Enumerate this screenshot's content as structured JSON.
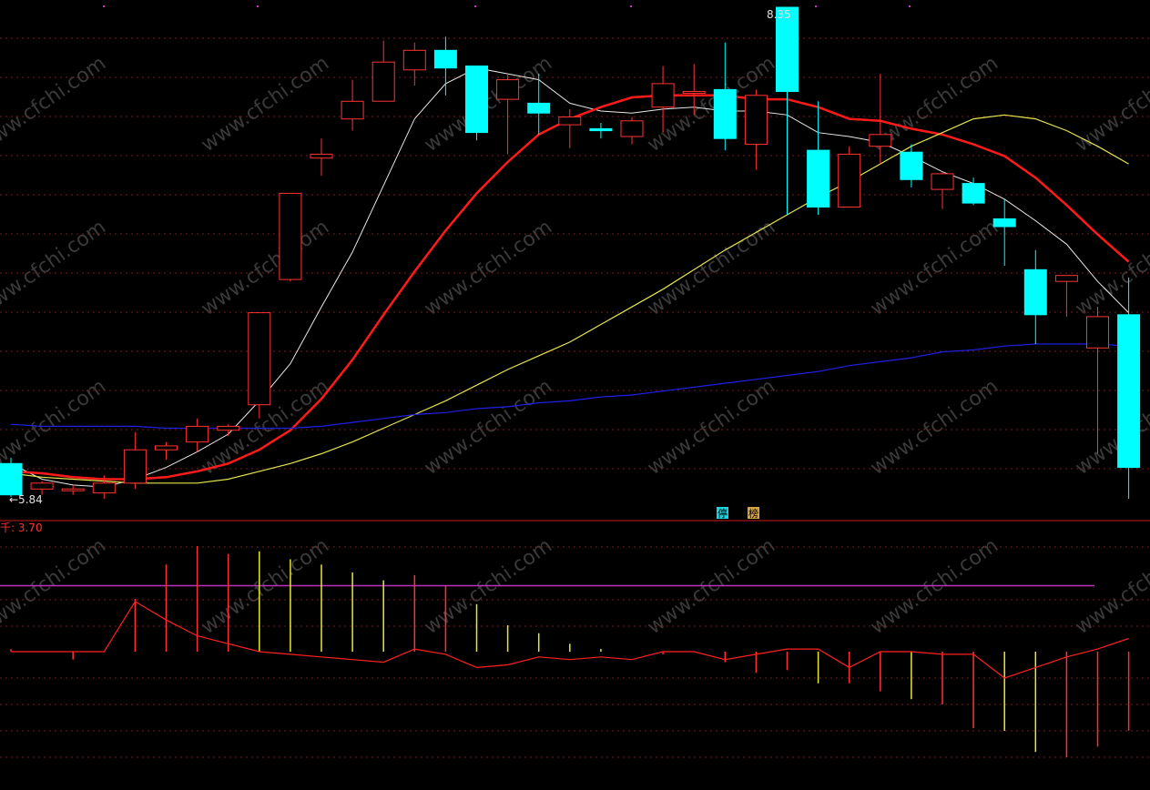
{
  "chart_data": [
    {
      "type": "candlestick",
      "panel": "main",
      "annotations": {
        "high_label": "8.35",
        "low_label": "←5.84",
        "tags": [
          {
            "text": "停",
            "bg": "#1ad6e6"
          },
          {
            "text": "榜",
            "bg": "#d9a441"
          }
        ]
      },
      "watermark": "www.cfchi.com",
      "colors": {
        "up": "#ff3232",
        "down": "#00ffff",
        "ma_fast": "#e8e8e8",
        "ma_mid": "#ff1a1a",
        "ma_slow": "#e6e64d",
        "ma_long": "#1f1fe6",
        "grid": "#7a1a1a"
      },
      "candles": [
        {
          "open": 6.02,
          "high": 6.05,
          "low": 5.85,
          "close": 5.86
        },
        {
          "open": 5.89,
          "high": 5.93,
          "low": 5.86,
          "close": 5.92
        },
        {
          "open": 5.89,
          "high": 5.91,
          "low": 5.86,
          "close": 5.89
        },
        {
          "open": 5.87,
          "high": 5.96,
          "low": 5.84,
          "close": 5.92
        },
        {
          "open": 5.92,
          "high": 6.18,
          "low": 5.89,
          "close": 6.09
        },
        {
          "open": 6.09,
          "high": 6.13,
          "low": 6.04,
          "close": 6.11
        },
        {
          "open": 6.13,
          "high": 6.25,
          "low": 6.08,
          "close": 6.21
        },
        {
          "open": 6.19,
          "high": 6.22,
          "low": 6.16,
          "close": 6.21
        },
        {
          "open": 6.32,
          "high": 6.58,
          "low": 6.25,
          "close": 6.79
        },
        {
          "open": 6.96,
          "high": 7.34,
          "low": 6.95,
          "close": 7.4
        },
        {
          "open": 7.58,
          "high": 7.68,
          "low": 7.49,
          "close": 7.6
        },
        {
          "open": 7.78,
          "high": 7.98,
          "low": 7.72,
          "close": 7.87
        },
        {
          "open": 7.87,
          "high": 8.18,
          "low": 7.89,
          "close": 8.07
        },
        {
          "open": 8.03,
          "high": 8.17,
          "low": 7.95,
          "close": 8.13
        },
        {
          "open": 8.13,
          "high": 8.2,
          "low": 7.9,
          "close": 8.04
        },
        {
          "open": 8.05,
          "high": 7.98,
          "low": 7.67,
          "close": 7.71
        },
        {
          "open": 7.88,
          "high": 8.01,
          "low": 7.6,
          "close": 7.98
        },
        {
          "open": 7.86,
          "high": 8.01,
          "low": 7.7,
          "close": 7.81
        },
        {
          "open": 7.75,
          "high": 7.83,
          "low": 7.63,
          "close": 7.79
        },
        {
          "open": 7.73,
          "high": 7.76,
          "low": 7.68,
          "close": 7.72
        },
        {
          "open": 7.69,
          "high": 7.79,
          "low": 7.65,
          "close": 7.77
        },
        {
          "open": 7.84,
          "high": 8.05,
          "low": 7.71,
          "close": 7.96
        },
        {
          "open": 7.92,
          "high": 8.06,
          "low": 7.8,
          "close": 7.92
        },
        {
          "open": 7.93,
          "high": 8.17,
          "low": 7.62,
          "close": 7.68
        },
        {
          "open": 7.65,
          "high": 7.93,
          "low": 7.52,
          "close": 7.9
        },
        {
          "open": 8.35,
          "high": 8.35,
          "low": 7.29,
          "close": 7.92
        },
        {
          "open": 7.62,
          "high": 7.87,
          "low": 7.29,
          "close": 7.33
        },
        {
          "open": 7.33,
          "high": 7.64,
          "low": 7.33,
          "close": 7.6
        },
        {
          "open": 7.64,
          "high": 8.01,
          "low": 7.55,
          "close": 7.7
        },
        {
          "open": 7.61,
          "high": 7.65,
          "low": 7.43,
          "close": 7.47
        },
        {
          "open": 7.42,
          "high": 7.51,
          "low": 7.32,
          "close": 7.5
        },
        {
          "open": 7.45,
          "high": 7.48,
          "low": 7.34,
          "close": 7.35
        },
        {
          "open": 7.27,
          "high": 7.37,
          "low": 7.03,
          "close": 7.23
        },
        {
          "open": 7.01,
          "high": 7.11,
          "low": 6.63,
          "close": 6.78
        },
        {
          "open": 6.95,
          "high": 6.83,
          "low": 6.77,
          "close": 6.98
        },
        {
          "open": 6.61,
          "high": 6.82,
          "low": 6.07,
          "close": 6.77
        },
        {
          "open": 6.78,
          "high": 6.97,
          "low": 5.84,
          "close": 6.0
        }
      ],
      "moving_averages": [
        {
          "series_key": "ma_fast",
          "values": [
            6.02,
            5.94,
            5.91,
            5.9,
            5.94,
            6.0,
            6.08,
            6.17,
            6.34,
            6.53,
            6.82,
            7.1,
            7.44,
            7.78,
            7.96,
            8.04,
            8.01,
            7.98,
            7.86,
            7.82,
            7.81,
            7.83,
            7.84,
            7.82,
            7.82,
            7.8,
            7.71,
            7.69,
            7.66,
            7.59,
            7.51,
            7.45,
            7.37,
            7.26,
            7.14,
            6.95,
            6.79
          ]
        },
        {
          "series_key": "ma_mid",
          "values": [
            5.98,
            5.97,
            5.95,
            5.94,
            5.94,
            5.95,
            5.98,
            6.02,
            6.09,
            6.19,
            6.35,
            6.55,
            6.78,
            7.0,
            7.21,
            7.4,
            7.56,
            7.7,
            7.78,
            7.84,
            7.89,
            7.9,
            7.9,
            7.9,
            7.88,
            7.88,
            7.84,
            7.78,
            7.77,
            7.73,
            7.7,
            7.65,
            7.59,
            7.48,
            7.34,
            7.19,
            7.05
          ]
        },
        {
          "series_key": "ma_slow",
          "values": [
            5.97,
            5.95,
            5.94,
            5.93,
            5.92,
            5.92,
            5.92,
            5.94,
            5.98,
            6.02,
            6.07,
            6.13,
            6.2,
            6.27,
            6.34,
            6.42,
            6.5,
            6.57,
            6.64,
            6.73,
            6.82,
            6.91,
            7.01,
            7.11,
            7.2,
            7.29,
            7.38,
            7.46,
            7.55,
            7.64,
            7.71,
            7.78,
            7.8,
            7.78,
            7.72,
            7.64,
            7.55
          ]
        },
        {
          "series_key": "ma_long",
          "values": [
            6.22,
            6.21,
            6.21,
            6.21,
            6.21,
            6.2,
            6.2,
            6.2,
            6.2,
            6.2,
            6.21,
            6.23,
            6.25,
            6.27,
            6.28,
            6.3,
            6.31,
            6.33,
            6.34,
            6.36,
            6.37,
            6.39,
            6.41,
            6.43,
            6.45,
            6.47,
            6.49,
            6.52,
            6.54,
            6.56,
            6.59,
            6.6,
            6.62,
            6.63,
            6.63,
            6.63,
            6.62
          ]
        }
      ]
    },
    {
      "type": "bar",
      "panel": "indicator",
      "label": "千: 3.70",
      "level_line": 2.5,
      "bar_colors": {
        "red": "#ff3030",
        "yellow": "#e8e832"
      },
      "bars": [
        {
          "value": 0.1,
          "color": "red"
        },
        {
          "value": 0.0,
          "color": "red"
        },
        {
          "value": -0.3,
          "color": "red"
        },
        {
          "value": 0.0,
          "color": "yellow"
        },
        {
          "value": 2.0,
          "color": "red"
        },
        {
          "value": 3.3,
          "color": "red"
        },
        {
          "value": 4.0,
          "color": "red"
        },
        {
          "value": 3.7,
          "color": "red"
        },
        {
          "value": 3.8,
          "color": "yellow"
        },
        {
          "value": 3.5,
          "color": "yellow"
        },
        {
          "value": 3.3,
          "color": "yellow"
        },
        {
          "value": 3.0,
          "color": "yellow"
        },
        {
          "value": 2.7,
          "color": "yellow"
        },
        {
          "value": 2.9,
          "color": "red"
        },
        {
          "value": 2.5,
          "color": "red"
        },
        {
          "value": 1.8,
          "color": "yellow"
        },
        {
          "value": 1.0,
          "color": "yellow"
        },
        {
          "value": 0.7,
          "color": "yellow"
        },
        {
          "value": 0.3,
          "color": "yellow"
        },
        {
          "value": 0.1,
          "color": "yellow"
        },
        {
          "value": 0.0,
          "color": "yellow"
        },
        {
          "value": -0.1,
          "color": "red"
        },
        {
          "value": 0.0,
          "color": "yellow"
        },
        {
          "value": -0.4,
          "color": "red"
        },
        {
          "value": -0.8,
          "color": "red"
        },
        {
          "value": -0.7,
          "color": "red"
        },
        {
          "value": -1.2,
          "color": "yellow"
        },
        {
          "value": -1.2,
          "color": "red"
        },
        {
          "value": -1.5,
          "color": "red"
        },
        {
          "value": -1.8,
          "color": "yellow"
        },
        {
          "value": -2.0,
          "color": "red"
        },
        {
          "value": -2.9,
          "color": "red"
        },
        {
          "value": -3.0,
          "color": "yellow"
        },
        {
          "value": -3.8,
          "color": "yellow"
        },
        {
          "value": -4.0,
          "color": "red"
        },
        {
          "value": -3.6,
          "color": "red"
        },
        {
          "value": -3.0,
          "color": "red"
        }
      ],
      "signal_line": [
        0.0,
        0.0,
        0.0,
        0.0,
        1.9,
        1.2,
        0.6,
        0.3,
        0.0,
        -0.1,
        -0.2,
        -0.3,
        -0.4,
        0.1,
        -0.1,
        -0.6,
        -0.5,
        -0.2,
        -0.3,
        -0.2,
        -0.3,
        0.0,
        0.0,
        -0.3,
        -0.1,
        0.1,
        0.1,
        -0.6,
        0.0,
        0.0,
        -0.1,
        -0.1,
        -1.0,
        -0.6,
        -0.2,
        0.1,
        0.5
      ]
    }
  ]
}
